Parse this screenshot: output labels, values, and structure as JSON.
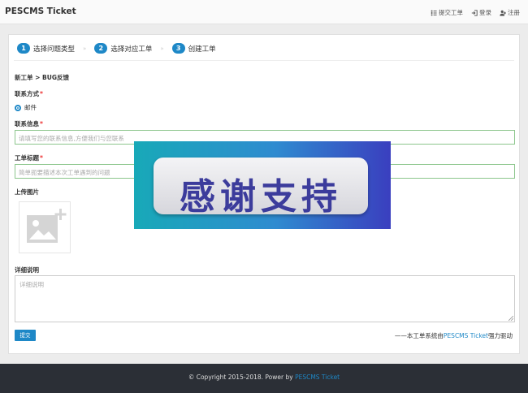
{
  "header": {
    "brand": "PESCMS Ticket",
    "nav": [
      {
        "label": "提交工单",
        "icon": "list-icon"
      },
      {
        "label": "登录",
        "icon": "login-icon"
      },
      {
        "label": "注册",
        "icon": "user-plus-icon"
      }
    ]
  },
  "steps": [
    {
      "num": "1",
      "label": "选择问题类型"
    },
    {
      "num": "2",
      "label": "选择对应工单"
    },
    {
      "num": "3",
      "label": "创建工单"
    }
  ],
  "breadcrumb": "新工单 > BUG反馈",
  "form": {
    "contact_method": {
      "label": "联系方式",
      "option": "邮件"
    },
    "contact_info": {
      "label": "联系信息",
      "placeholder": "请填写您的联系信息,方便我们与您联系"
    },
    "ticket_title": {
      "label": "工单标题",
      "placeholder": "简单扼要描述本次工单遇到的问题"
    },
    "upload": {
      "label": "上传图片"
    },
    "details": {
      "label": "详细说明",
      "placeholder": "详细说明"
    },
    "submit_label": "提交",
    "powered_prefix": "——本工单系统由",
    "powered_link": "PESCMS Ticket",
    "powered_suffix": "强力驱动"
  },
  "overlay_banner": {
    "text": "感谢支持"
  },
  "footer": {
    "copyright": "© Copyright 2015-2018. Power by ",
    "link": "PESCMS Ticket"
  },
  "colors": {
    "accent": "#1e88c7",
    "footer_bg": "#2b2f36",
    "input_border": "#8cc68c",
    "required": "#e33333"
  }
}
